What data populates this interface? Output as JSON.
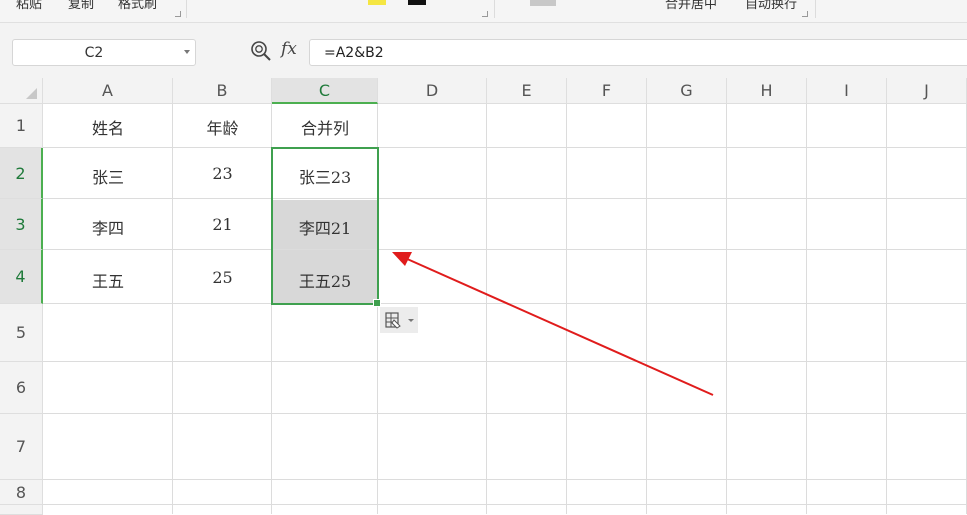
{
  "toolbar": {
    "fragments": [
      "粘贴",
      "复制",
      "格式刷",
      "合并居中",
      "自动换行"
    ]
  },
  "formula_bar": {
    "name_box": "C2",
    "fx_label": "fx",
    "formula": "=A2&B2"
  },
  "columns": [
    "A",
    "B",
    "C",
    "D",
    "E",
    "F",
    "G",
    "H",
    "I",
    "J"
  ],
  "selected_column": "C",
  "rows": [
    "1",
    "2",
    "3",
    "4",
    "5",
    "6",
    "7",
    "8"
  ],
  "selected_rows": [
    "2",
    "3",
    "4"
  ],
  "cells": {
    "A1": "姓名",
    "B1": "年龄",
    "C1": "合并列",
    "A2": "张三",
    "B2": "23",
    "C2": "张三23",
    "A3": "李四",
    "B3": "21",
    "C3": "李四21",
    "A4": "王五",
    "B4": "25",
    "C4": "王五25"
  },
  "selection_range": "C2:C4",
  "colors": {
    "selection_border": "#3fa04f",
    "annotation_arrow": "#e01c1c",
    "selection_fill": "#d8d8d8"
  },
  "icons": [
    "zoom-formula-icon",
    "paste-options-icon",
    "dropdown-arrow-icon",
    "select-all-triangle-icon"
  ]
}
